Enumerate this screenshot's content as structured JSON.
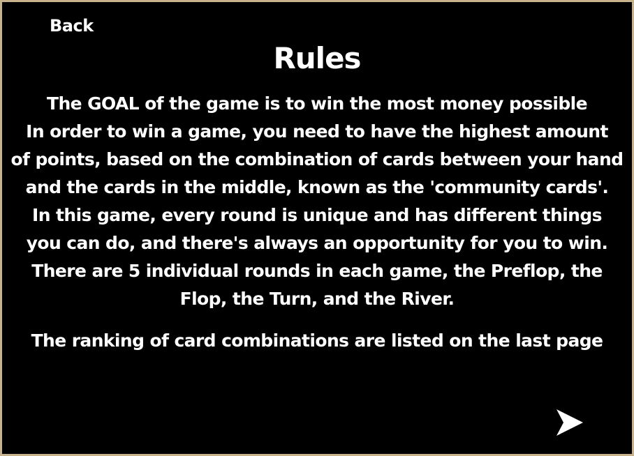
{
  "header": {
    "back_label": "Back",
    "title": "Rules"
  },
  "rules": {
    "lines": [
      "The GOAL of the game is to win the most money possible",
      "In order to win a game, you need to have the highest amount",
      "of points, based on the combination of cards between your hand",
      "and the cards in the middle, known as the 'community cards'.",
      "In this game, every round is unique and has different things",
      "you can do, and there's always an opportunity for you to win.",
      "There are 5 individual rounds in each game, the Preflop, the",
      "Flop, the Turn, and the River."
    ],
    "ranking_note": "The ranking of card combinations are listed on the last page"
  },
  "navigation": {
    "next_icon": "arrow-right-icon"
  },
  "colors": {
    "background": "#000000",
    "border": "#c8b28c",
    "text": "#ffffff"
  }
}
